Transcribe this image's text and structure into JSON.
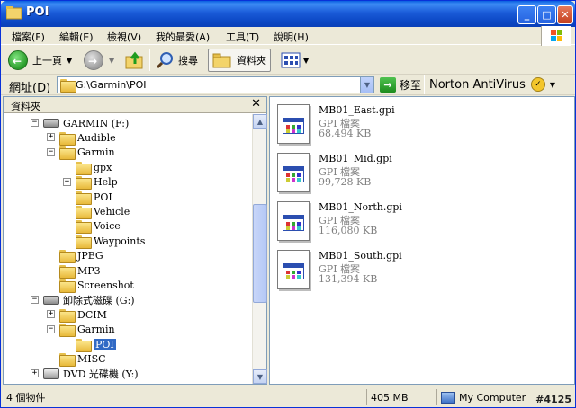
{
  "window": {
    "title": "POI"
  },
  "menu": [
    "檔案(F)",
    "編輯(E)",
    "檢視(V)",
    "我的最愛(A)",
    "工具(T)",
    "說明(H)"
  ],
  "toolbar": {
    "back_label": "上一頁",
    "search_label": "搜尋",
    "folders_label": "資料夾"
  },
  "address": {
    "label": "網址(D)",
    "value": "G:\\Garmin\\POI",
    "go_label": "移至",
    "norton_label": "Norton AntiVirus"
  },
  "tree": {
    "header": "資料夾",
    "items": [
      {
        "label": "GARMIN (F:)",
        "icon": "drive-icon",
        "expander": "−"
      },
      {
        "label": "Audible",
        "icon": "folder-icon",
        "expander": "+"
      },
      {
        "label": "Garmin",
        "icon": "folder-icon",
        "expander": "−"
      },
      {
        "label": "gpx",
        "icon": "folder-icon",
        "expander": ""
      },
      {
        "label": "Help",
        "icon": "folder-icon",
        "expander": "+"
      },
      {
        "label": "POI",
        "icon": "folder-icon",
        "expander": ""
      },
      {
        "label": "Vehicle",
        "icon": "folder-icon",
        "expander": ""
      },
      {
        "label": "Voice",
        "icon": "folder-icon",
        "expander": ""
      },
      {
        "label": "Waypoints",
        "icon": "folder-icon",
        "expander": ""
      },
      {
        "label": "JPEG",
        "icon": "folder-icon",
        "expander": ""
      },
      {
        "label": "MP3",
        "icon": "folder-icon",
        "expander": ""
      },
      {
        "label": "Screenshot",
        "icon": "folder-icon",
        "expander": ""
      },
      {
        "label": "卸除式磁碟 (G:)",
        "icon": "drive-icon",
        "expander": "−"
      },
      {
        "label": "DCIM",
        "icon": "folder-icon",
        "expander": "+"
      },
      {
        "label": "Garmin",
        "icon": "folder-icon",
        "expander": "−"
      },
      {
        "label": "POI",
        "icon": "folder-icon",
        "expander": "",
        "selected": true
      },
      {
        "label": "MISC",
        "icon": "folder-icon",
        "expander": ""
      },
      {
        "label": "DVD 光碟機 (Y:)",
        "icon": "dvd-icon",
        "expander": "+"
      }
    ]
  },
  "files": [
    {
      "name": "MB01_East.gpi",
      "type": "GPI 檔案",
      "size": "68,494 KB"
    },
    {
      "name": "MB01_Mid.gpi",
      "type": "GPI 檔案",
      "size": "99,728 KB"
    },
    {
      "name": "MB01_North.gpi",
      "type": "GPI 檔案",
      "size": "116,080 KB"
    },
    {
      "name": "MB01_South.gpi",
      "type": "GPI 檔案",
      "size": "131,394 KB"
    }
  ],
  "status": {
    "count": "4 個物件",
    "size": "405 MB",
    "location": "My Computer",
    "watermark": "#4125"
  }
}
